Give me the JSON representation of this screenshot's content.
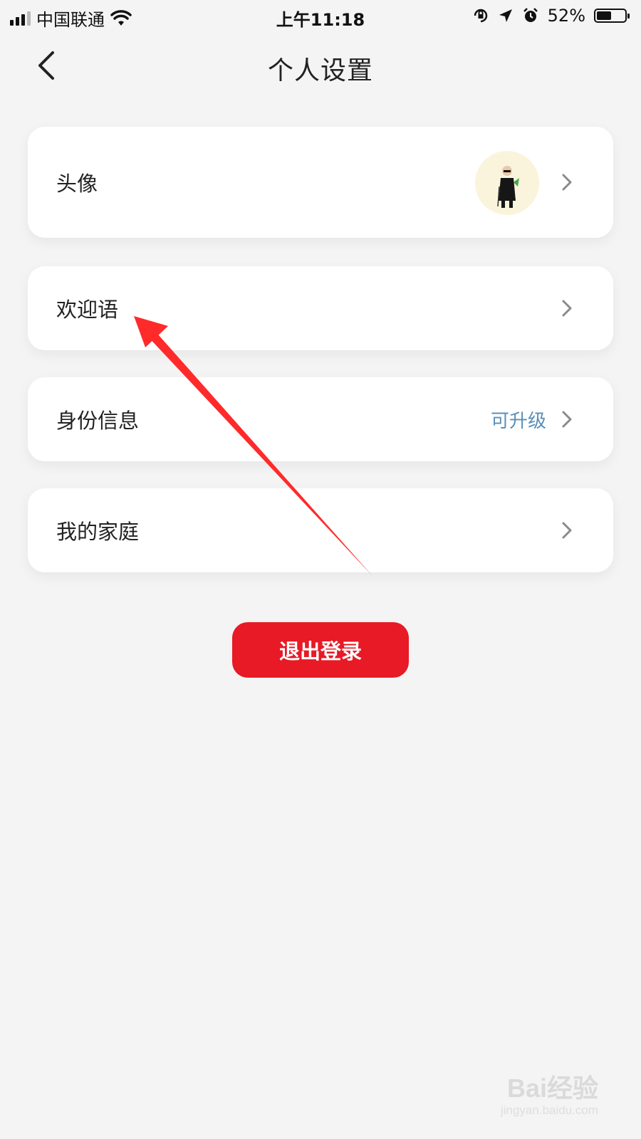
{
  "status_bar": {
    "carrier": "中国联通",
    "time": "上午11:18",
    "battery": "52%",
    "battery_level": 0.52,
    "icons": [
      "signal-icon",
      "wifi-icon",
      "rotation-lock-icon",
      "location-icon",
      "alarm-icon",
      "battery-icon"
    ]
  },
  "nav": {
    "title": "个人设置",
    "back_icon": "back-icon"
  },
  "settings": {
    "avatar": {
      "label": "头像",
      "icon": "avatar-image"
    },
    "welcome": {
      "label": "欢迎语"
    },
    "identity": {
      "label": "身份信息",
      "value": "可升级"
    },
    "family": {
      "label": "我的家庭"
    }
  },
  "logout": {
    "label": "退出登录"
  },
  "colors": {
    "background": "#f4f4f4",
    "card": "#ffffff",
    "primary_red": "#e71a25",
    "link_blue": "#5a8fb8",
    "annotation_arrow": "#ff2a2a"
  },
  "watermark": {
    "brand": "Bai经验",
    "url": "jingyan.baidu.com"
  }
}
